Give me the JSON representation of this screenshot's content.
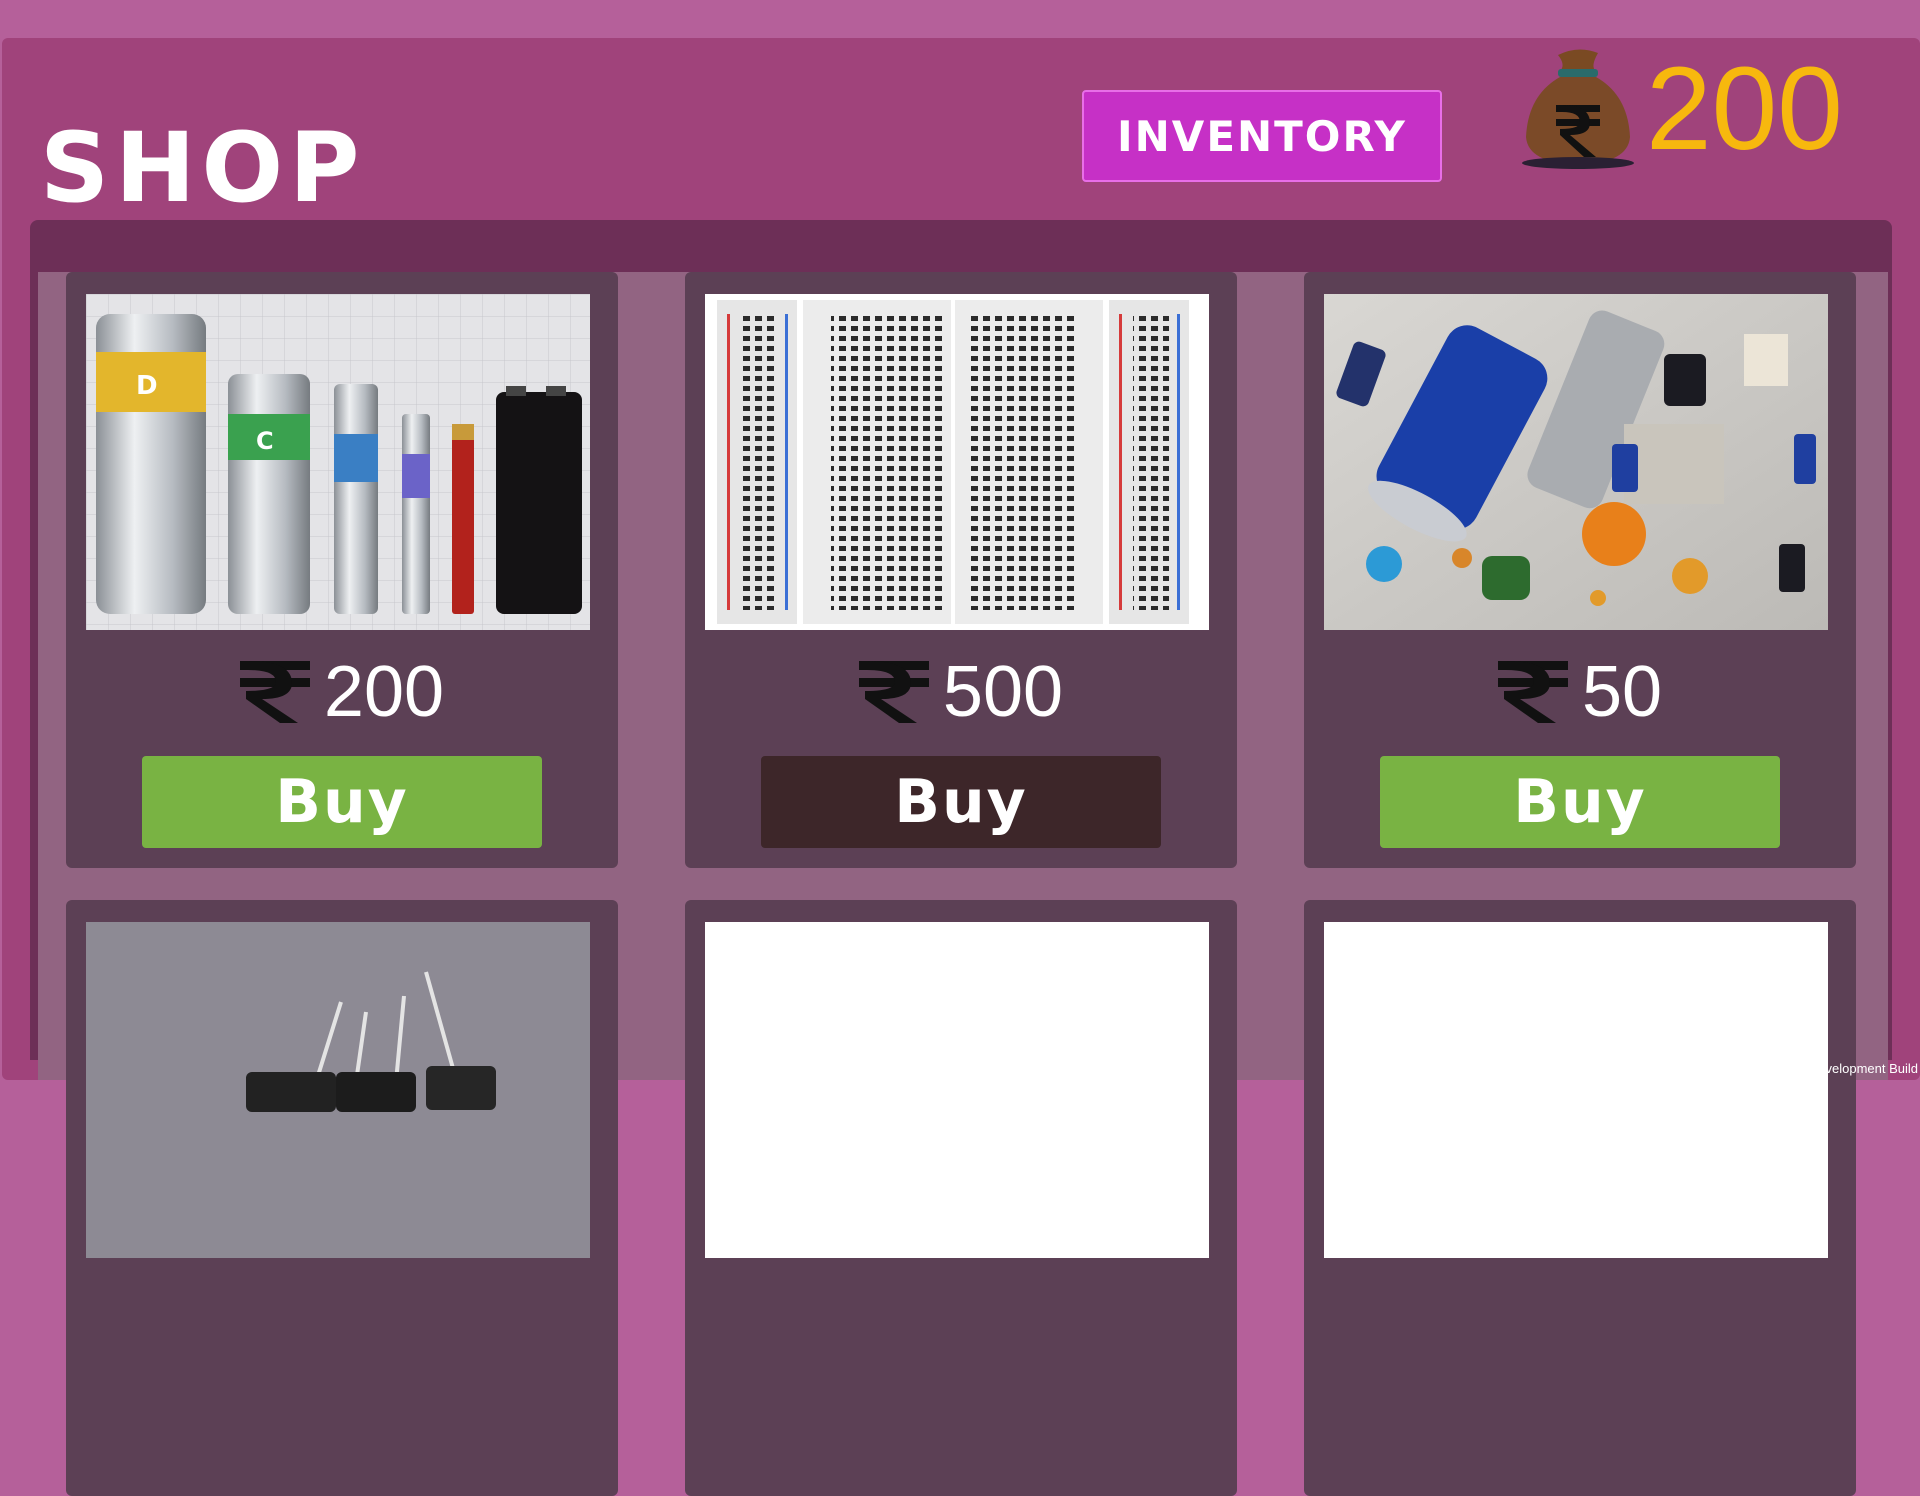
{
  "shop": {
    "title": "SHOP",
    "inventory_label": "INVENTORY",
    "coins": "200",
    "currency_symbol": "₹"
  },
  "items": [
    {
      "price": "200",
      "buy_label": "Buy",
      "image": "batteries-photo",
      "enabled": true
    },
    {
      "price": "500",
      "buy_label": "Buy",
      "image": "breadboard-photo",
      "enabled": false
    },
    {
      "price": "50",
      "buy_label": "Buy",
      "image": "capacitors-photo",
      "enabled": true
    }
  ],
  "row2": [
    {
      "image": "diodes-photo"
    },
    {
      "image": "blank"
    },
    {
      "image": "blank"
    }
  ],
  "footer": {
    "dev_build": "Development Build"
  },
  "colors": {
    "background": "#b5609a",
    "panel": "#a0437b",
    "inventory_button": "#c630c6",
    "coins": "#f7b80e",
    "card": "#5c4055",
    "buy_enabled": "#79b343",
    "buy_disabled": "#3d2629"
  }
}
